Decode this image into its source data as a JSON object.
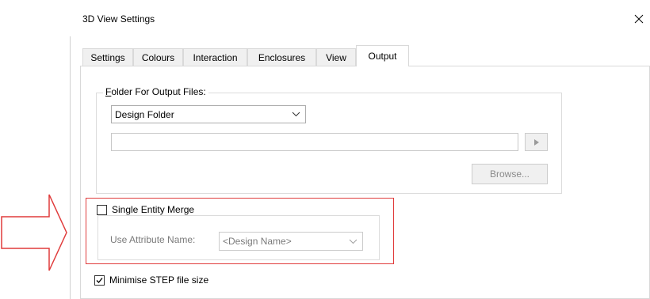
{
  "window": {
    "title": "3D View Settings",
    "close_icon": "close-icon"
  },
  "tabs": [
    {
      "label": "Settings"
    },
    {
      "label": "Colours"
    },
    {
      "label": "Interaction"
    },
    {
      "label": "Enclosures"
    },
    {
      "label": "View"
    },
    {
      "label": "Output",
      "active": true
    }
  ],
  "output": {
    "folder_group_label": "Folder For Output Files:",
    "folder_select_value": "Design Folder",
    "path_value": "",
    "browse_label": "Browse...",
    "merge": {
      "checkbox_label": "Single Entity Merge",
      "checked": false,
      "attr_label": "Use Attribute Name:",
      "attr_value": "<Design Name>"
    },
    "minimise": {
      "label": "Minimise STEP file size",
      "checked": true
    }
  },
  "annotation": {
    "arrow_icon": "arrow-right-icon",
    "color": "#e03c3c"
  }
}
